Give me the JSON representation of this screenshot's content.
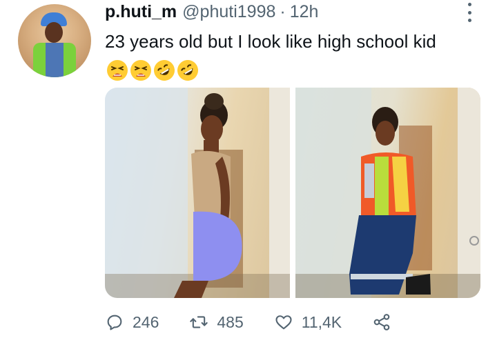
{
  "tweet": {
    "display_name": "p.huti_m",
    "handle": "@phuti1998",
    "separator": "·",
    "time": "12h",
    "text": "23 years old but I look like high school kid",
    "emojis": [
      "tired-face-emoji",
      "tired-face-emoji",
      "rolling-on-floor-laughing-emoji",
      "rolling-on-floor-laughing-emoji"
    ]
  },
  "actions": {
    "replies": "246",
    "retweets": "485",
    "likes": "11,4K"
  },
  "colors": {
    "text": "#0f1419",
    "secondary": "#536471",
    "emoji_yellow": "#ffcc33"
  }
}
